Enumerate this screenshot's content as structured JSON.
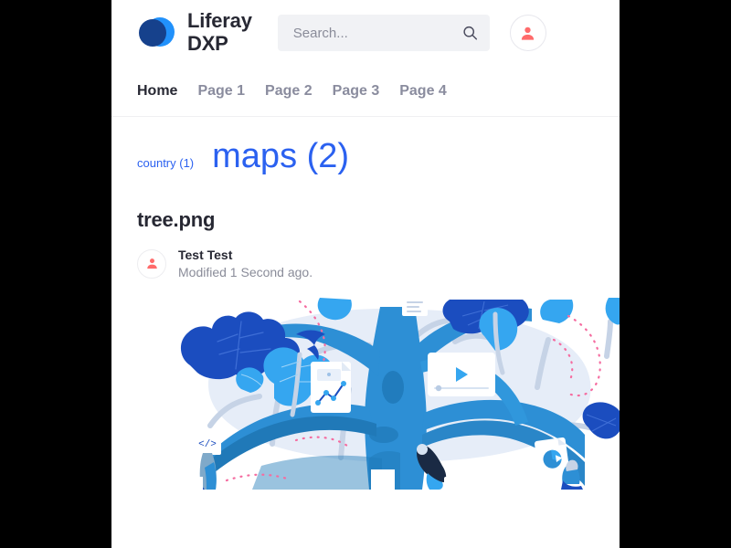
{
  "header": {
    "logo_icon": "liferay-logo-icon",
    "brand_line1": "Liferay",
    "brand_line2": "DXP",
    "brand_name": "Liferay DXP",
    "search_placeholder": "Search...",
    "search_value": "",
    "search_icon": "search-icon",
    "user_icon": "user-avatar-icon",
    "colors": {
      "logo_light": "#2191FB",
      "logo_dark": "#16418C",
      "avatar": "#FF6B6B",
      "search_bg": "#F1F2F5"
    }
  },
  "nav": {
    "items": [
      {
        "label": "Home",
        "active": true
      },
      {
        "label": "Page 1",
        "active": false
      },
      {
        "label": "Page 2",
        "active": false
      },
      {
        "label": "Page 3",
        "active": false
      },
      {
        "label": "Page 4",
        "active": false
      }
    ]
  },
  "tag_cloud": {
    "accent_color": "#2B61F0",
    "tags": [
      {
        "label": "country (1)",
        "name": "country",
        "count": 1,
        "size": "small"
      },
      {
        "label": "maps (2)",
        "name": "maps",
        "count": 2,
        "size": "large"
      }
    ]
  },
  "document": {
    "title": "tree.png",
    "author": "Test Test",
    "modified": "Modified 1 Second ago.",
    "avatar_icon": "user-avatar-icon",
    "preview_alt": "tree illustration"
  },
  "illustration": {
    "name": "tree-illustration",
    "colors": {
      "trunk_mid": "#2D8FD5",
      "trunk_dark": "#2079B8",
      "trunk_light": "#4AA8E8",
      "leaf_navy": "#1B4DBF",
      "leaf_blue": "#35A6F0",
      "backdrop": "#E4ECF7",
      "branch_gray": "#C9D6E8",
      "dots_pink": "#F56CA0",
      "card_white": "#FFFFFF"
    },
    "cards": [
      {
        "name": "code-card",
        "glyph": "</>"
      },
      {
        "name": "chart-document-card",
        "glyph": "line-chart"
      },
      {
        "name": "video-player-card",
        "glyph": "play"
      },
      {
        "name": "pie-chart-card",
        "glyph": "pie-chart"
      },
      {
        "name": "text-document-card",
        "glyph": "lines"
      }
    ]
  }
}
